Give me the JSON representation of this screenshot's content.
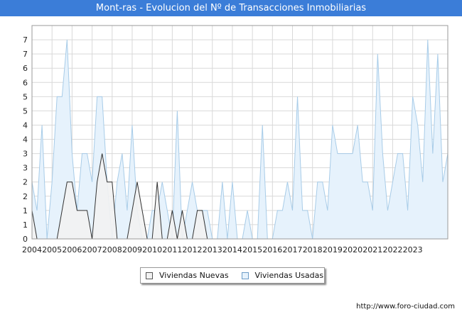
{
  "header": {
    "title": "Mont-ras - Evolucion del Nº de Transacciones Inmobiliarias"
  },
  "legend": {
    "nuevas": "Viviendas Nuevas",
    "usadas": "Viviendas Usadas"
  },
  "footer": {
    "source": "http://www.foro-ciudad.com"
  },
  "chart_data": {
    "type": "area",
    "title": "Mont-ras - Evolucion del Nº de Transacciones Inmobiliarias",
    "x_axis": {
      "type": "quarterly",
      "start": "2004 Q1",
      "end": "2023 Q3"
    },
    "y_tick_labels": [
      "0",
      "1",
      "1",
      "2",
      "2",
      "3",
      "3",
      "4",
      "4",
      "5",
      "5",
      "6",
      "6",
      "7",
      "7"
    ],
    "ylim": [
      0,
      7.5
    ],
    "x_tick_labels": [
      "2004",
      "2005",
      "2006",
      "2007",
      "2008",
      "2009",
      "2010",
      "2011",
      "2012",
      "2013",
      "2014",
      "2015",
      "2016",
      "2017",
      "2018",
      "2019",
      "2020",
      "2021",
      "2022",
      "2023"
    ],
    "grid": true,
    "legend_position": "bottom-center",
    "series": [
      {
        "name": "Viviendas Nuevas",
        "color": "#f2f2f2",
        "line_color": "#333333",
        "values": [
          1,
          0,
          0,
          0,
          0,
          0,
          1,
          2,
          2,
          1,
          1,
          1,
          0,
          2,
          3,
          2,
          2,
          0,
          0,
          0,
          1,
          2,
          1,
          0,
          0,
          2,
          0,
          0,
          1,
          0,
          1,
          0,
          0,
          1,
          1,
          0,
          0,
          0,
          0,
          0,
          0,
          0,
          0,
          0,
          0,
          0,
          0,
          0,
          0,
          0,
          0,
          0,
          0,
          0,
          0,
          0,
          0,
          0,
          0,
          0,
          0,
          0,
          0,
          0,
          0,
          0,
          0,
          0,
          0,
          0,
          0,
          0,
          0,
          0,
          0,
          0,
          0,
          0,
          0
        ]
      },
      {
        "name": "Viviendas Usadas",
        "color": "#e6f2fc",
        "line_color": "#a8cce8",
        "values": [
          2,
          1,
          4,
          0,
          2,
          5,
          5,
          7,
          3,
          1,
          3,
          3,
          2,
          5,
          5,
          2,
          0,
          2,
          3,
          1,
          4,
          1,
          0,
          0,
          1,
          1,
          2,
          1,
          0,
          4.5,
          0,
          1,
          2,
          1,
          1,
          1,
          0,
          0,
          2,
          0,
          2,
          0,
          0,
          1,
          0,
          0,
          4,
          0,
          0,
          1,
          1,
          2,
          1,
          5,
          1,
          1,
          0,
          2,
          2,
          1,
          4,
          3,
          3,
          3,
          3,
          4,
          2,
          2,
          1,
          6.5,
          3,
          1,
          2,
          3,
          3,
          1,
          5,
          4,
          2,
          7,
          3,
          6.5,
          2,
          3
        ]
      }
    ]
  }
}
